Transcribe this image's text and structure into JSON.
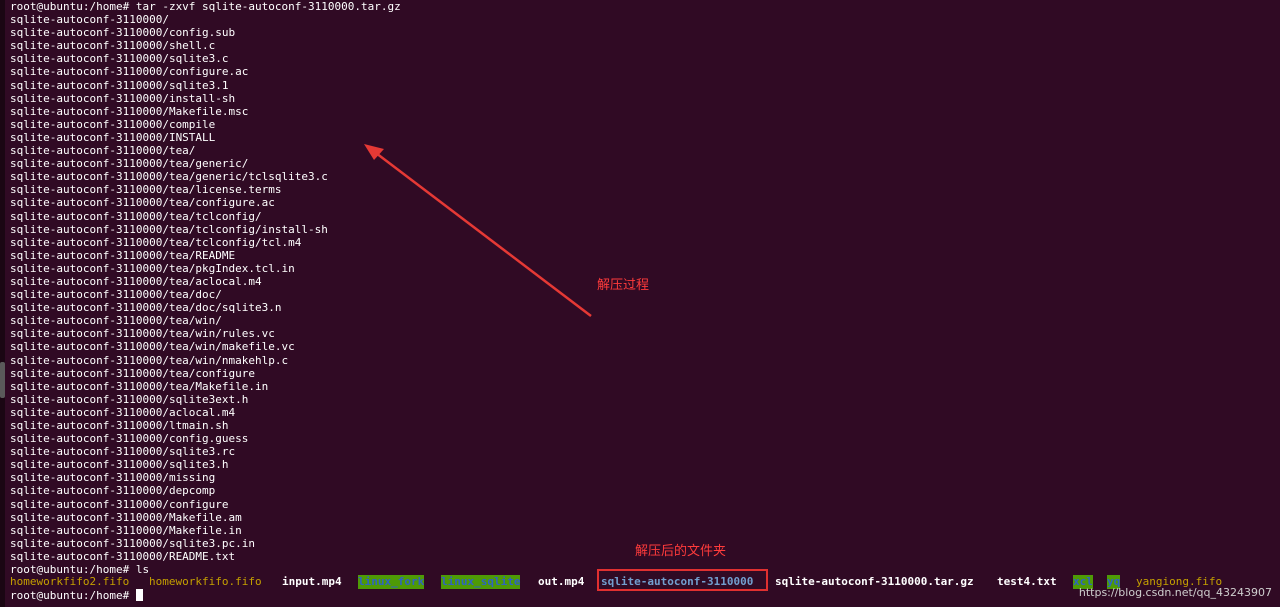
{
  "terminal": {
    "command_line": "root@ubuntu:/home# tar -zxvf sqlite-autoconf-3110000.tar.gz",
    "output_lines": [
      "sqlite-autoconf-3110000/",
      "sqlite-autoconf-3110000/config.sub",
      "sqlite-autoconf-3110000/shell.c",
      "sqlite-autoconf-3110000/sqlite3.c",
      "sqlite-autoconf-3110000/configure.ac",
      "sqlite-autoconf-3110000/sqlite3.1",
      "sqlite-autoconf-3110000/install-sh",
      "sqlite-autoconf-3110000/Makefile.msc",
      "sqlite-autoconf-3110000/compile",
      "sqlite-autoconf-3110000/INSTALL",
      "sqlite-autoconf-3110000/tea/",
      "sqlite-autoconf-3110000/tea/generic/",
      "sqlite-autoconf-3110000/tea/generic/tclsqlite3.c",
      "sqlite-autoconf-3110000/tea/license.terms",
      "sqlite-autoconf-3110000/tea/configure.ac",
      "sqlite-autoconf-3110000/tea/tclconfig/",
      "sqlite-autoconf-3110000/tea/tclconfig/install-sh",
      "sqlite-autoconf-3110000/tea/tclconfig/tcl.m4",
      "sqlite-autoconf-3110000/tea/README",
      "sqlite-autoconf-3110000/tea/pkgIndex.tcl.in",
      "sqlite-autoconf-3110000/tea/aclocal.m4",
      "sqlite-autoconf-3110000/tea/doc/",
      "sqlite-autoconf-3110000/tea/doc/sqlite3.n",
      "sqlite-autoconf-3110000/tea/win/",
      "sqlite-autoconf-3110000/tea/win/rules.vc",
      "sqlite-autoconf-3110000/tea/win/makefile.vc",
      "sqlite-autoconf-3110000/tea/win/nmakehlp.c",
      "sqlite-autoconf-3110000/tea/configure",
      "sqlite-autoconf-3110000/tea/Makefile.in",
      "sqlite-autoconf-3110000/sqlite3ext.h",
      "sqlite-autoconf-3110000/aclocal.m4",
      "sqlite-autoconf-3110000/ltmain.sh",
      "sqlite-autoconf-3110000/config.guess",
      "sqlite-autoconf-3110000/sqlite3.rc",
      "sqlite-autoconf-3110000/sqlite3.h",
      "sqlite-autoconf-3110000/missing",
      "sqlite-autoconf-3110000/depcomp",
      "sqlite-autoconf-3110000/configure",
      "sqlite-autoconf-3110000/Makefile.am",
      "sqlite-autoconf-3110000/Makefile.in",
      "sqlite-autoconf-3110000/sqlite3.pc.in",
      "sqlite-autoconf-3110000/README.txt"
    ],
    "ls_command_line": "root@ubuntu:/home# ls",
    "ls_items": [
      {
        "name": "homeworkfifo2.fifo",
        "kind": "fifo"
      },
      {
        "name": "homeworkfifo.fifo",
        "kind": "fifo"
      },
      {
        "name": "input.mp4",
        "kind": "exe"
      },
      {
        "name": "linux_fork",
        "kind": "dir-green"
      },
      {
        "name": "linux_sqlite",
        "kind": "dir-green"
      },
      {
        "name": "out.mp4",
        "kind": "exe"
      },
      {
        "name": "sqlite-autoconf-3110000",
        "kind": "dir-blue"
      },
      {
        "name": "sqlite-autoconf-3110000.tar.gz",
        "kind": "tarfile"
      },
      {
        "name": "test4.txt",
        "kind": "exe"
      },
      {
        "name": "xcl",
        "kind": "dir-green"
      },
      {
        "name": "yq",
        "kind": "dir-green"
      },
      {
        "name": "yangiong.fifo",
        "kind": "fifo"
      }
    ],
    "final_prompt": "root@ubuntu:/home# "
  },
  "annotations": {
    "extraction_label": "解压过程",
    "folder_label": "解压后的文件夹"
  },
  "watermark": "https://blog.csdn.net/qq_43243907",
  "colors": {
    "background": "#300a24",
    "annotation": "#ff3b3b",
    "fifo": "#c4a000",
    "dir_green_bg": "#4e9a06",
    "dir_blue": "#729fcf"
  }
}
